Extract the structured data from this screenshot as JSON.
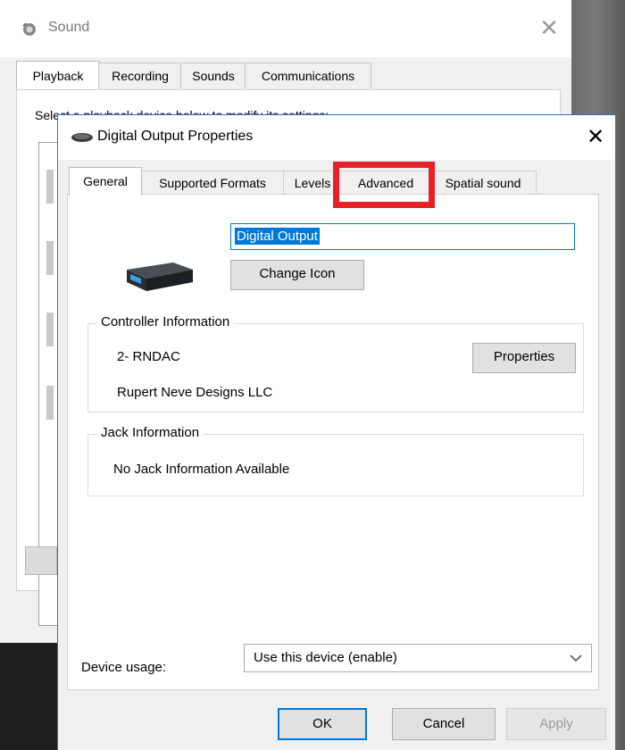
{
  "sound_window": {
    "title": "Sound",
    "tabs": [
      "Playback",
      "Recording",
      "Sounds",
      "Communications"
    ],
    "panel_text": "Select a playback device below to modify its settings:"
  },
  "dialog": {
    "title": "Digital Output Properties",
    "tabs": [
      "General",
      "Supported Formats",
      "Levels",
      "Advanced",
      "Spatial sound"
    ],
    "active_tab": "General",
    "highlighted_tab": "Advanced",
    "device_name": "Digital Output",
    "change_icon_label": "Change Icon",
    "controller": {
      "group_title": "Controller Information",
      "name": "2- RNDAC",
      "vendor": "Rupert Neve Designs LLC",
      "properties_label": "Properties"
    },
    "jack": {
      "group_title": "Jack Information",
      "text": "No Jack Information Available"
    },
    "device_usage": {
      "label": "Device usage:",
      "value": "Use this device (enable)"
    },
    "buttons": {
      "ok": "OK",
      "cancel": "Cancel",
      "apply": "Apply"
    }
  },
  "colors": {
    "highlight": "#e8202a",
    "accent": "#0078d7"
  }
}
